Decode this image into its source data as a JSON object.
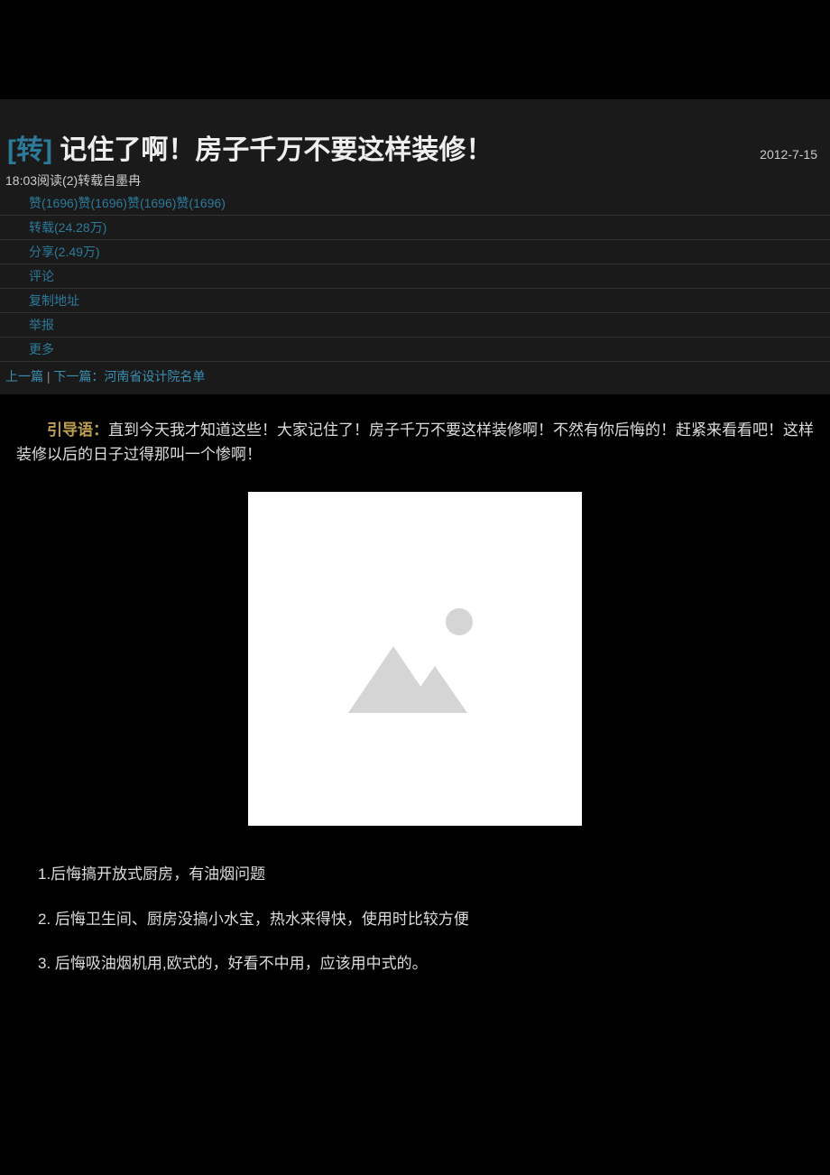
{
  "header": {
    "title_prefix": "[转]",
    "title": " 记住了啊！房子千万不要这样装修！",
    "date": "2012-7-15"
  },
  "meta": {
    "time": "18:03",
    "read_label": "阅读",
    "read_count": "(2)",
    "repost_from_label": "转载自",
    "repost_from_user": "墨冉"
  },
  "actions": {
    "like_label": "赞",
    "like_count": "(1696)",
    "repost_label": "转载",
    "repost_count": "(24.28万)",
    "share_label": "分享",
    "share_count": "(2.49万)",
    "comment_label": "评论",
    "copy_label": "复制地址",
    "report_label": "举报",
    "more_label": "更多"
  },
  "nav": {
    "prev_label": "上一篇",
    "sep": " |",
    "next_label": "下一篇：",
    "next_title": "河南省设计院名单"
  },
  "content": {
    "intro_label": "引导语：",
    "intro_text": "直到今天我才知道这些！大家记住了！房子千万不要这样装修啊！不然有你后悔的！赶紧来看看吧！这样装修以后的日子过得那叫一个惨啊！",
    "items": [
      "1.后悔搞开放式厨房，有油烟问题",
      "2. 后悔卫生间、厨房没搞小水宝，热水来得快，使用时比较方便",
      "3. 后悔吸油烟机用,欧式的，好看不中用，应该用中式的。"
    ]
  }
}
